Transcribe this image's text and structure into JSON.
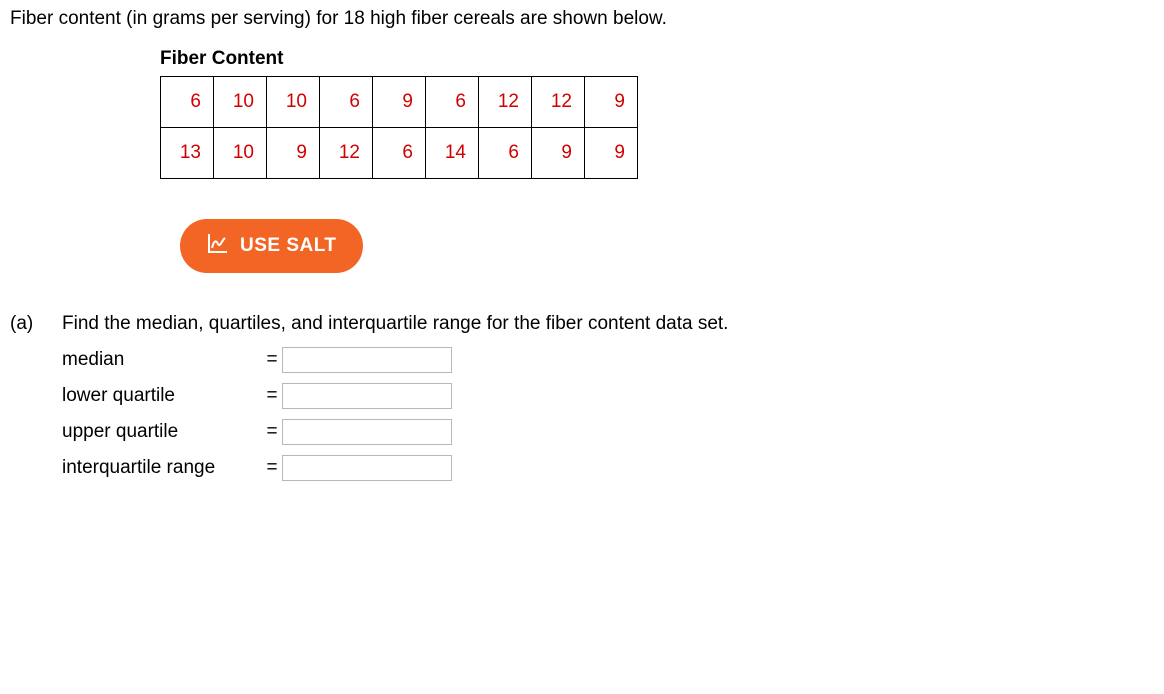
{
  "intro": "Fiber content (in grams per serving) for 18 high fiber cereals are shown below.",
  "table": {
    "title": "Fiber Content",
    "rows": [
      [
        "6",
        "10",
        "10",
        "6",
        "9",
        "6",
        "12",
        "12",
        "9"
      ],
      [
        "13",
        "10",
        "9",
        "12",
        "6",
        "14",
        "6",
        "9",
        "9"
      ]
    ]
  },
  "salt_button": "USE SALT",
  "part_a": {
    "marker": "(a)",
    "prompt": "Find the median, quartiles, and interquartile range for the fiber content data set.",
    "rows": [
      {
        "label": "median",
        "eq": "="
      },
      {
        "label": "lower quartile",
        "eq": "="
      },
      {
        "label": "upper quartile",
        "eq": "="
      },
      {
        "label": "interquartile range",
        "eq": "="
      }
    ]
  },
  "chart_data": {
    "type": "table",
    "title": "Fiber Content",
    "values": [
      6,
      10,
      10,
      6,
      9,
      6,
      12,
      12,
      9,
      13,
      10,
      9,
      12,
      6,
      14,
      6,
      9,
      9
    ]
  }
}
